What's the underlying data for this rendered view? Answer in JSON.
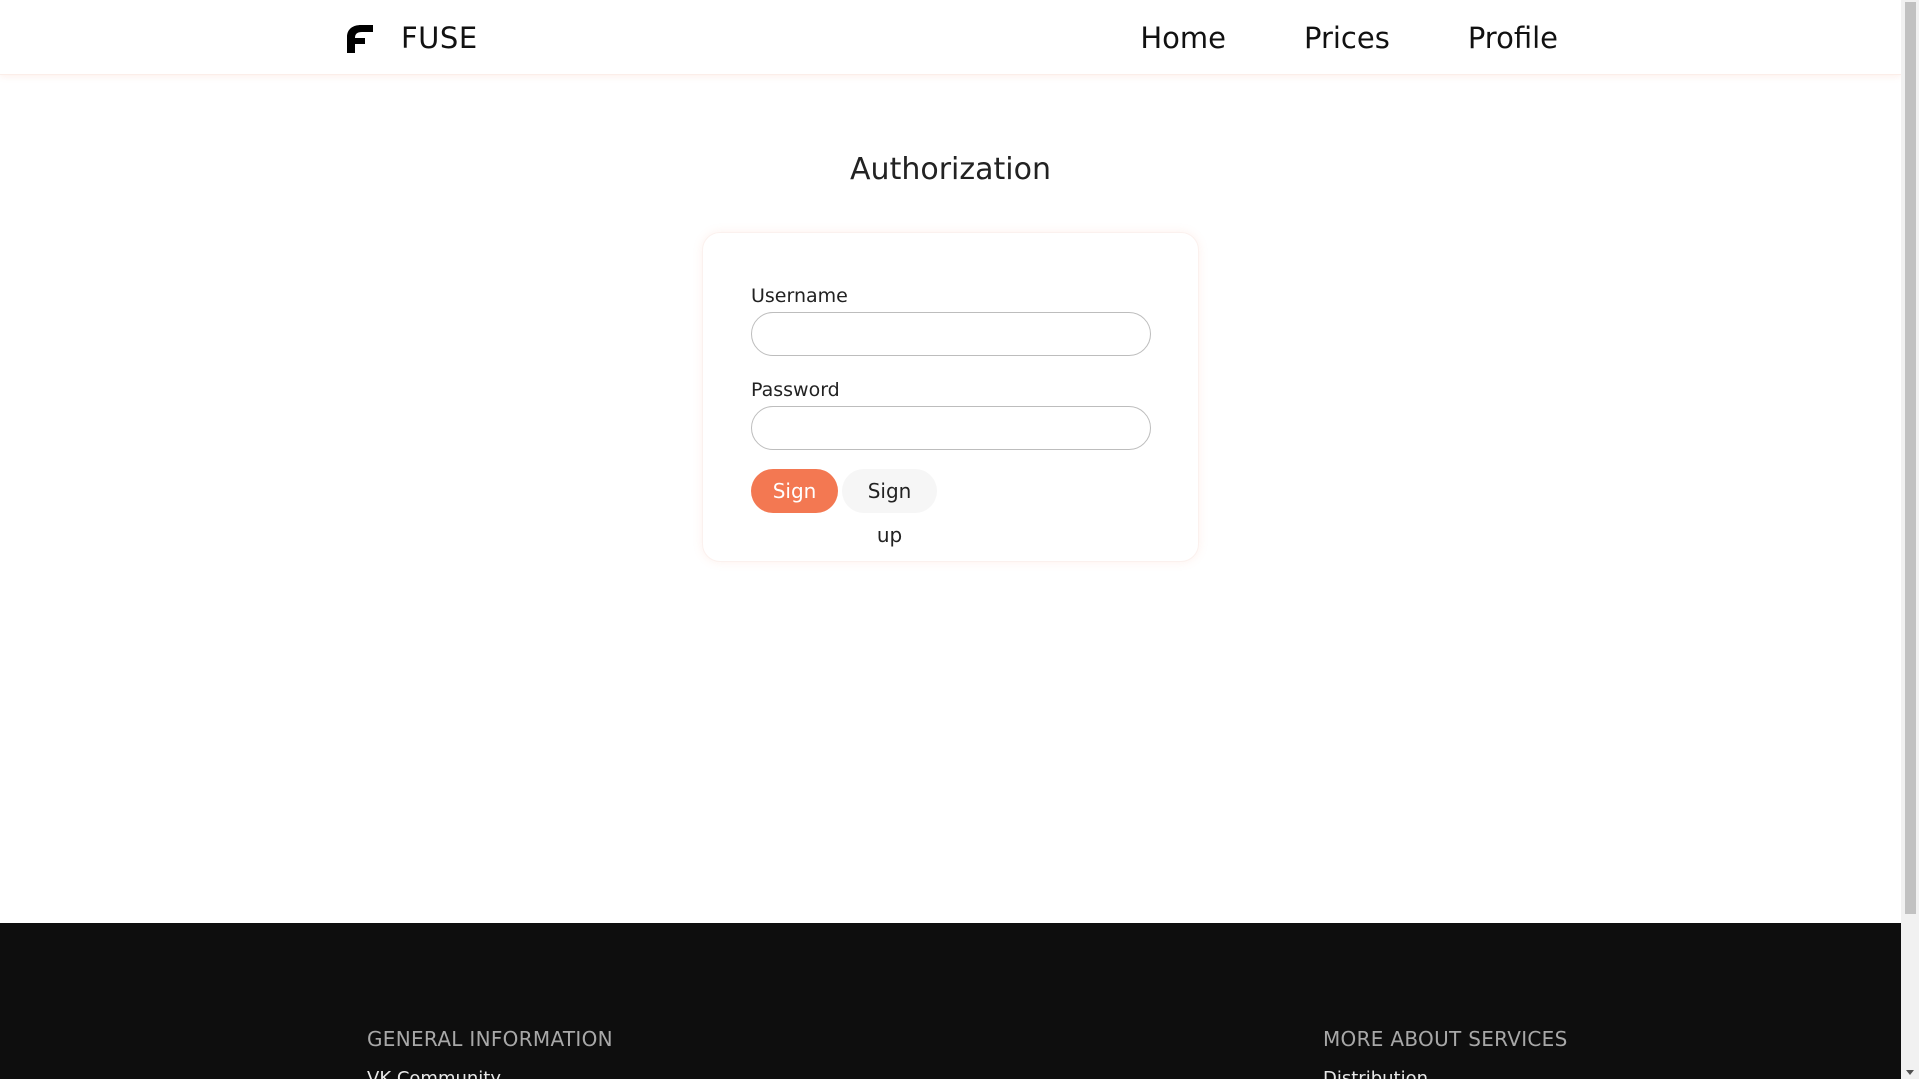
{
  "header": {
    "brand": "FUSE",
    "nav": [
      {
        "label": "Home"
      },
      {
        "label": "Prices"
      },
      {
        "label": "Profile"
      }
    ]
  },
  "main": {
    "title": "Authorization",
    "form": {
      "username_label": "Username",
      "username_value": "",
      "password_label": "Password",
      "password_value": "",
      "signin_label": "Sign in",
      "signup_label": "Sign up"
    }
  },
  "footer": {
    "columns": [
      {
        "heading": "GENERAL INFORMATION",
        "first_link": "VK Community"
      },
      {
        "heading": "MORE ABOUT SERVICES",
        "first_link": "Distribution"
      }
    ]
  },
  "colors": {
    "accent": "#f37852",
    "footer_bg": "#0e0e0e",
    "text": "#111111"
  },
  "icons": {
    "brand_logo": "fuse-logo-icon"
  }
}
